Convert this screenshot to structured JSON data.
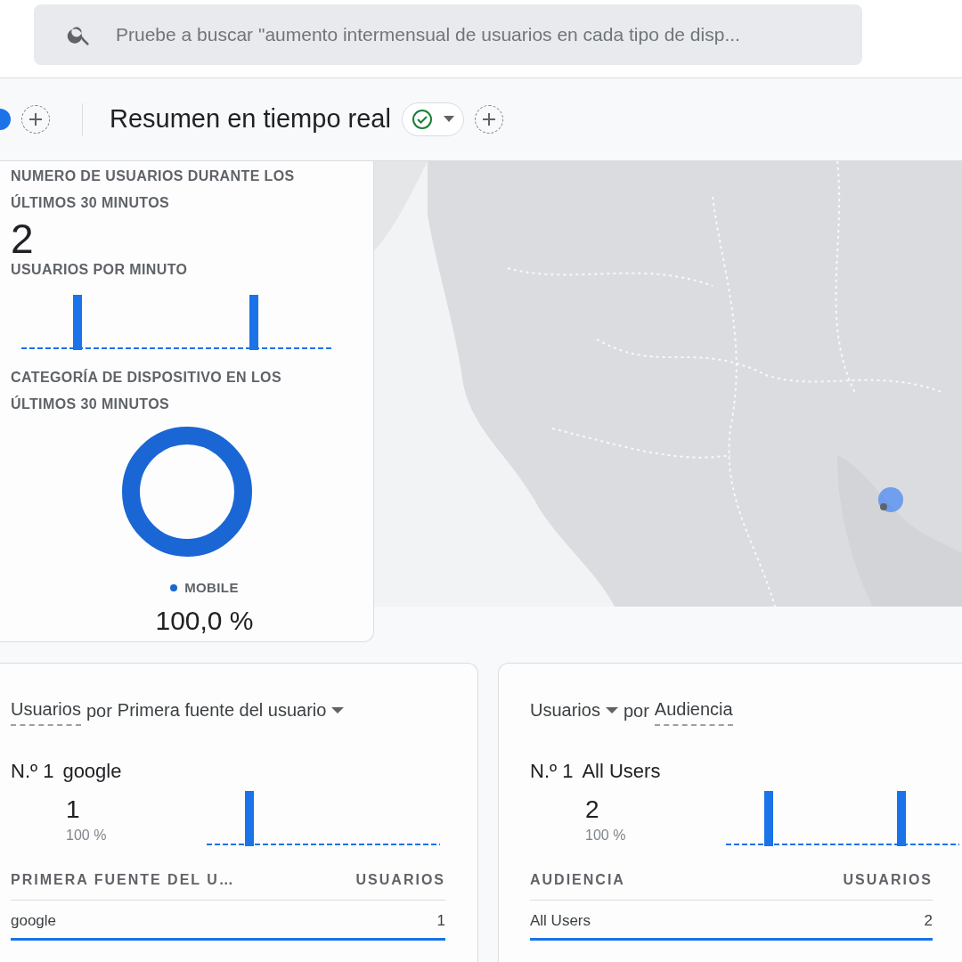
{
  "search": {
    "placeholder": "Pruebe a buscar \"aumento intermensual de usuarios en cada tipo de disp..."
  },
  "header": {
    "title": "Resumen en tiempo real",
    "status_ok": true
  },
  "realtime_card": {
    "users_heading": "NUMERO DE USUARIOS DURANTE LOS ÚLTIMOS 30 MINUTOS",
    "users_value": "2",
    "per_minute_heading": "USUARIOS POR MINUTO",
    "device_heading": "CATEGORÍA DE DISPOSITIVO EN LOS ÚLTIMOS 30 MINUTOS",
    "legend": [
      {
        "label": "MOBILE",
        "value": "100,0 %",
        "color": "#1a66d4"
      }
    ]
  },
  "cards": [
    {
      "metric": {
        "label": "Usuarios",
        "menu": false
      },
      "connector": "por",
      "dimension": {
        "label": "Primera fuente del usuario",
        "menu": true
      },
      "rank_label": "N.º 1",
      "top_name": "google",
      "top_value": "1",
      "top_share": "100 %",
      "columns": [
        "PRIMERA FUENTE DEL U…",
        "USUARIOS"
      ],
      "rows": [
        {
          "cells": [
            "google",
            "1"
          ]
        }
      ]
    },
    {
      "metric": {
        "label": "Usuarios",
        "menu": true
      },
      "connector": "por",
      "dimension": {
        "label": "Audiencia",
        "menu": false
      },
      "rank_label": "N.º 1",
      "top_name": "All Users",
      "top_value": "2",
      "top_share": "100 %",
      "columns": [
        "AUDIENCIA",
        "USUARIOS"
      ],
      "rows": [
        {
          "cells": [
            "All Users",
            "2"
          ]
        }
      ]
    }
  ]
}
